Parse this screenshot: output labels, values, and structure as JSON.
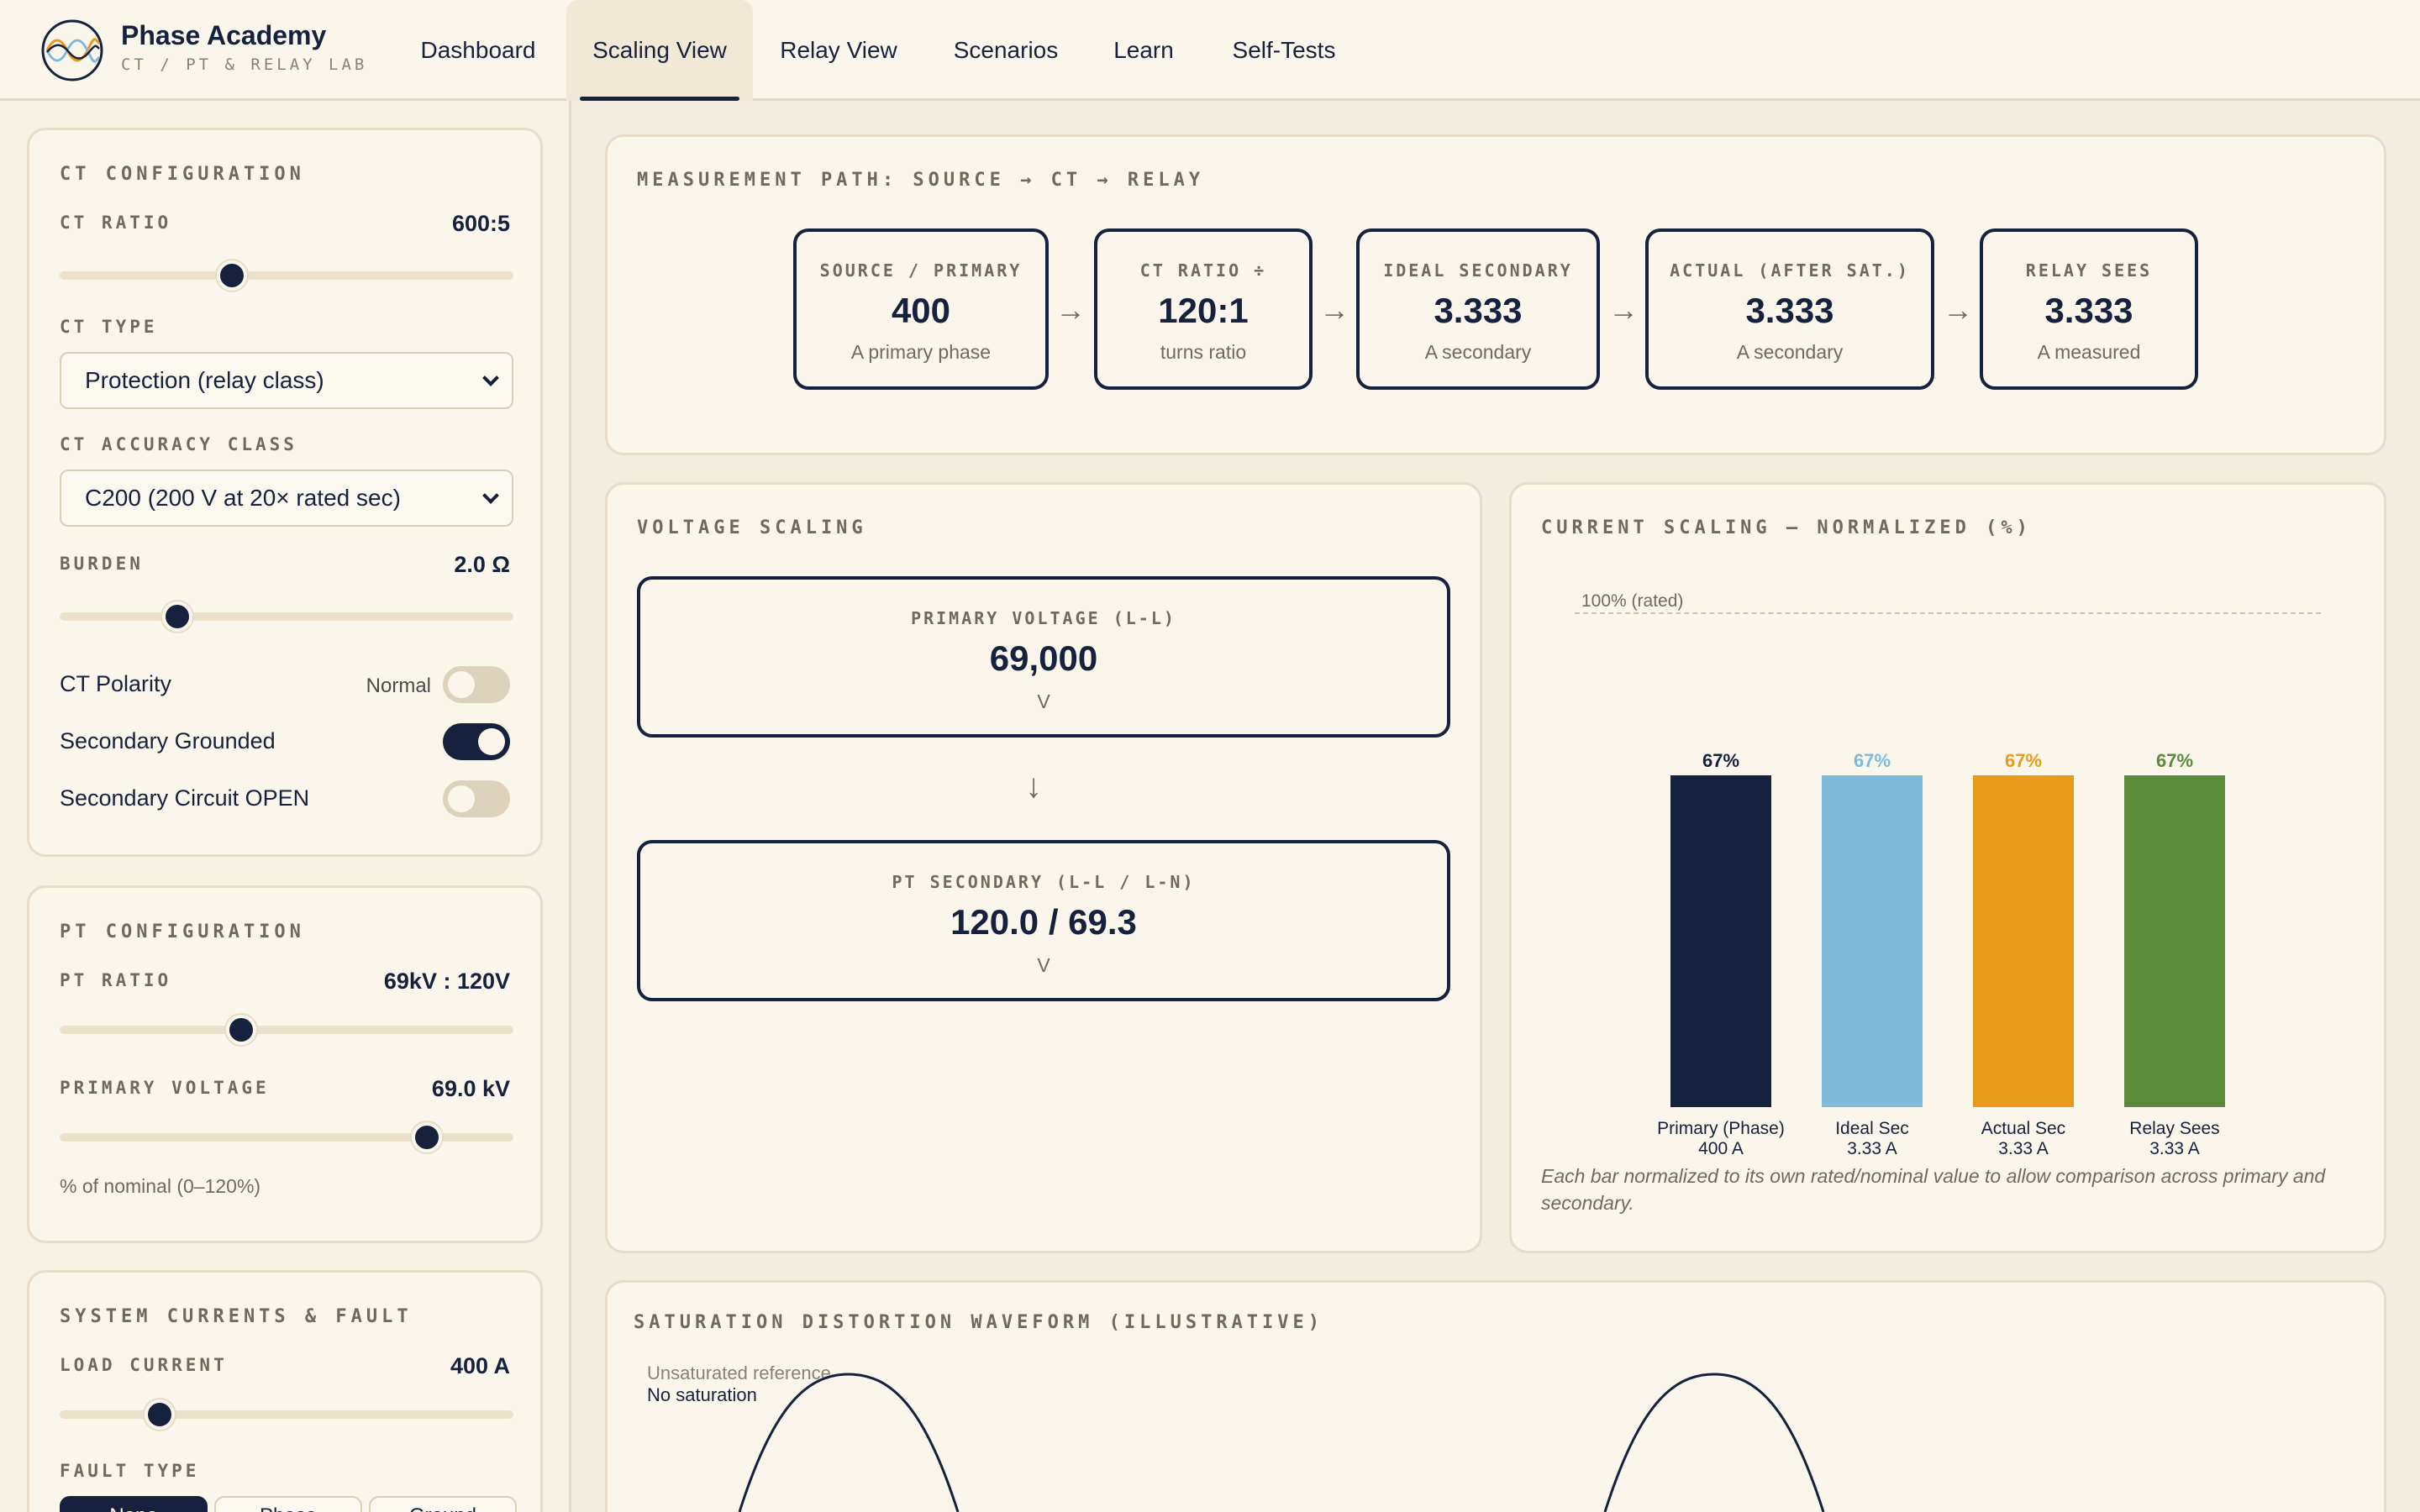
{
  "app": {
    "title": "Phase Academy",
    "subtitle": "CT / PT & RELAY LAB"
  },
  "tabs": [
    {
      "label": "Dashboard",
      "active": false
    },
    {
      "label": "Scaling View",
      "active": true
    },
    {
      "label": "Relay View",
      "active": false
    },
    {
      "label": "Scenarios",
      "active": false
    },
    {
      "label": "Learn",
      "active": false
    },
    {
      "label": "Self-Tests",
      "active": false
    }
  ],
  "ct_config": {
    "title": "CT CONFIGURATION",
    "ct_ratio_label": "CT RATIO",
    "ct_ratio_value": "600:5",
    "ct_ratio_slider": 0.38,
    "ct_type_label": "CT TYPE",
    "ct_type_value": "Protection (relay class)",
    "accuracy_label": "CT ACCURACY CLASS",
    "accuracy_value": "C200 (200 V at 20× rated sec)",
    "burden_label": "BURDEN",
    "burden_value": "2.0 Ω",
    "burden_slider": 0.26,
    "polarity_label": "CT Polarity",
    "polarity_note": "Normal",
    "polarity_on": false,
    "grounded_label": "Secondary Grounded",
    "grounded_on": true,
    "open_label": "Secondary Circuit OPEN",
    "open_on": false
  },
  "pt_config": {
    "title": "PT CONFIGURATION",
    "pt_ratio_label": "PT RATIO",
    "pt_ratio_value": "69kV : 120V",
    "pt_ratio_slider": 0.4,
    "primary_voltage_label": "PRIMARY VOLTAGE",
    "primary_voltage_value": "69.0 kV",
    "primary_voltage_slider": 0.81,
    "hint": "% of nominal (0–120%)"
  },
  "system": {
    "title": "SYSTEM CURRENTS & FAULT",
    "load_label": "LOAD CURRENT",
    "load_value": "400 A",
    "load_slider": 0.22,
    "fault_label": "FAULT TYPE",
    "fault_buttons": [
      "None",
      "Phase",
      "Ground"
    ]
  },
  "path": {
    "title": "MEASUREMENT PATH: SOURCE → CT → RELAY",
    "arrow": "→",
    "boxes": [
      {
        "label": "SOURCE / PRIMARY",
        "value": "400",
        "unit": "A primary phase"
      },
      {
        "label": "CT RATIO ÷",
        "value": "120:1",
        "unit": "turns ratio"
      },
      {
        "label": "IDEAL SECONDARY",
        "value": "3.333",
        "unit": "A secondary"
      },
      {
        "label": "ACTUAL (AFTER SAT.)",
        "value": "3.333",
        "unit": "A secondary"
      },
      {
        "label": "RELAY SEES",
        "value": "3.333",
        "unit": "A measured"
      }
    ]
  },
  "voltage": {
    "title": "VOLTAGE SCALING",
    "arrow": "↓",
    "primary": {
      "label": "PRIMARY VOLTAGE (L-L)",
      "value": "69,000",
      "unit": "V"
    },
    "secondary": {
      "label": "PT SECONDARY (L-L / L-N)",
      "value": "120.0 / 69.3",
      "unit": "V"
    }
  },
  "current_scaling": {
    "title": "CURRENT SCALING — NORMALIZED (%)",
    "reference_label": "100% (rated)",
    "note": "Each bar normalized to its own rated/nominal value to allow comparison across primary and secondary."
  },
  "chart_data": {
    "type": "bar",
    "title": "CURRENT SCALING — NORMALIZED (%)",
    "ylim": [
      0,
      100
    ],
    "reference_line": 100,
    "bars": [
      {
        "name": "Primary (Phase)",
        "amp": "400 A",
        "value": 67,
        "pct_label": "67%",
        "color": "#16213e"
      },
      {
        "name": "Ideal Sec",
        "amp": "3.33 A",
        "value": 67,
        "pct_label": "67%",
        "color": "#7fbadc"
      },
      {
        "name": "Actual Sec",
        "amp": "3.33 A",
        "value": 67,
        "pct_label": "67%",
        "color": "#e89a1c"
      },
      {
        "name": "Relay Sees",
        "amp": "3.33 A",
        "value": 67,
        "pct_label": "67%",
        "color": "#5b8a3c"
      }
    ]
  },
  "waveform": {
    "title": "SATURATION DISTORTION WAVEFORM (ILLUSTRATIVE)",
    "legend_reference": "Unsaturated reference",
    "legend_status": "No saturation"
  }
}
